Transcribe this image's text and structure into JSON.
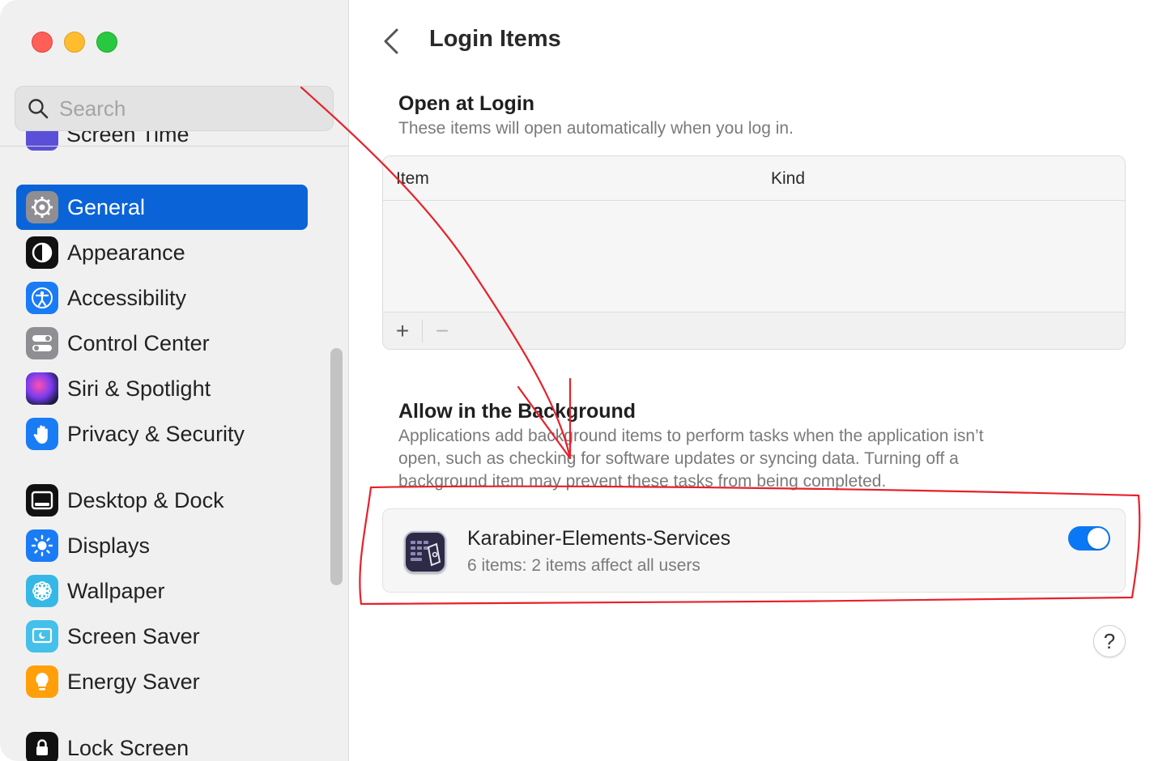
{
  "window": {
    "traffic_lights": [
      "close",
      "minimize",
      "zoom"
    ]
  },
  "sidebar": {
    "search_placeholder": "Search",
    "partial_item_label": "Screen Time",
    "items": [
      {
        "label": "General",
        "icon": "gear-icon",
        "active": true
      },
      {
        "label": "Appearance",
        "icon": "appearance-icon"
      },
      {
        "label": "Accessibility",
        "icon": "accessibility-icon"
      },
      {
        "label": "Control Center",
        "icon": "control-center-icon"
      },
      {
        "label": "Siri & Spotlight",
        "icon": "siri-icon"
      },
      {
        "label": "Privacy & Security",
        "icon": "hand-icon"
      },
      {
        "label": "Desktop & Dock",
        "icon": "dock-icon"
      },
      {
        "label": "Displays",
        "icon": "sun-icon"
      },
      {
        "label": "Wallpaper",
        "icon": "flower-icon"
      },
      {
        "label": "Screen Saver",
        "icon": "screen-saver-icon"
      },
      {
        "label": "Energy Saver",
        "icon": "bulb-icon"
      },
      {
        "label": "Lock Screen",
        "icon": "lock-icon"
      }
    ]
  },
  "main": {
    "title": "Login Items",
    "open_at_login": {
      "title": "Open at Login",
      "description": "These items will open automatically when you log in.",
      "columns": [
        "Item",
        "Kind"
      ],
      "add_label": "+",
      "remove_label": "−"
    },
    "allow_background": {
      "title": "Allow in the Background",
      "description_lines": [
        "Applications add background items to perform tasks when the application isn’t",
        "open, such as checking for software updates or syncing data. Turning off a",
        "background item may prevent these tasks from being completed."
      ],
      "items": [
        {
          "name": "Karabiner-Elements-Services",
          "subtitle": "6 items: 2 items affect all users",
          "enabled": true
        }
      ]
    },
    "help_label": "?"
  },
  "colors": {
    "accent": "#0a64d8",
    "toggle_on": "#0a78f5",
    "annotation": "#e8202a"
  }
}
